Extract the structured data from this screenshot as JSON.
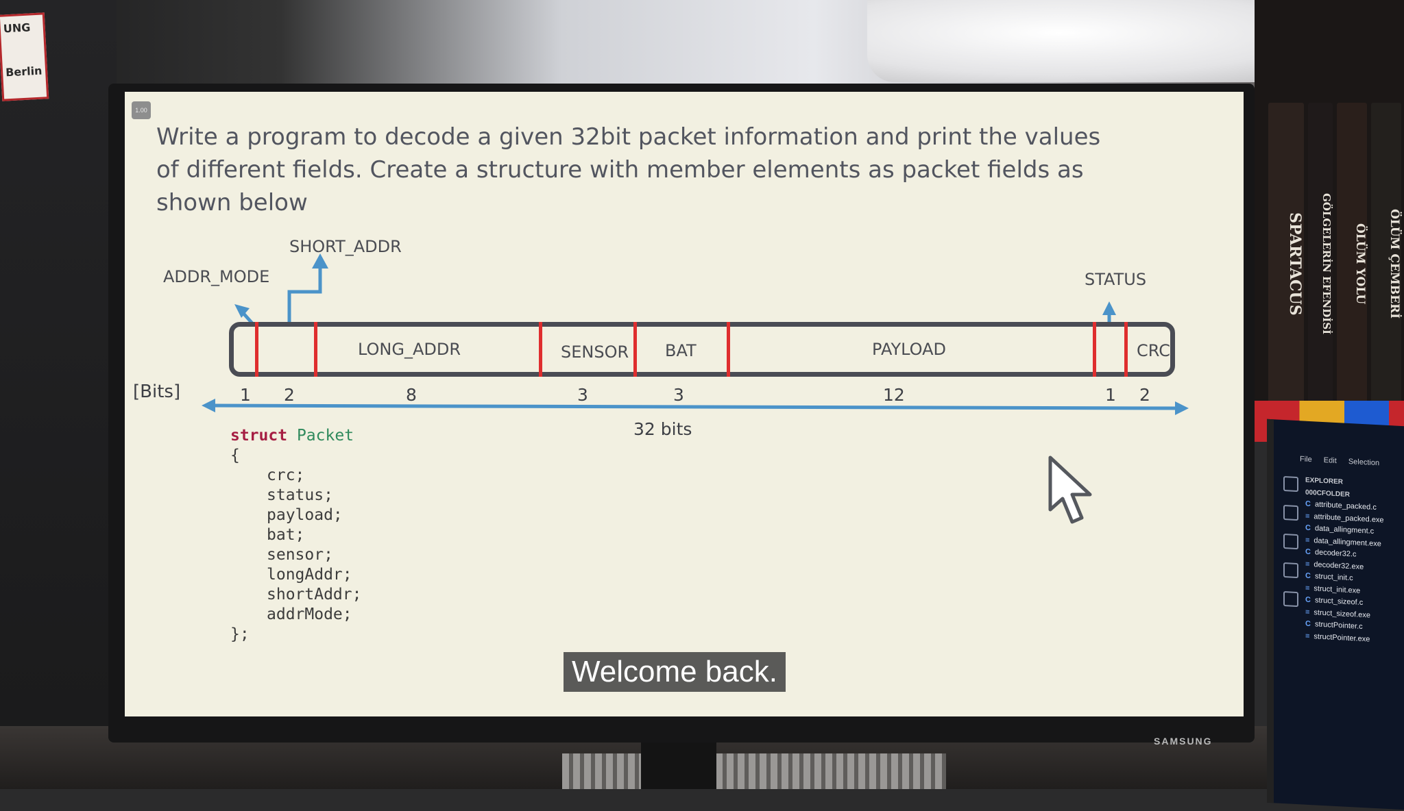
{
  "poster": {
    "line1": "UNG",
    "line2": "Berlin"
  },
  "books": [
    {
      "title": "SPARTACUS",
      "color": "#2c221e"
    },
    {
      "title": "GÖLGELERİN EFENDİSİ",
      "color": "#1f1a1a"
    },
    {
      "title": "ÖLÜM YOLU",
      "color": "#2a1f1b"
    },
    {
      "title": "ÖLÜM ÇEMBERİ",
      "color": "#23201d"
    }
  ],
  "monitor": {
    "brand": "SAMSUNG",
    "speed_badge": "1.00"
  },
  "slide": {
    "prompt": "Write a program to decode a given 32bit packet information  and print the values of different fields. Create a structure with member elements as packet fields as shown below",
    "fields": {
      "short_addr": "SHORT_ADDR",
      "addr_mode": "ADDR_MODE",
      "status": "STATUS",
      "long_addr": "LONG_ADDR",
      "sensor": "SENSOR",
      "bat": "BAT",
      "payload": "PAYLOAD",
      "crc": "CRC"
    },
    "bits_label": "[Bits]",
    "bits": [
      "1",
      "2",
      "8",
      "3",
      "3",
      "12",
      "1",
      "2"
    ],
    "total_label": "32 bits",
    "code": {
      "keyword": "struct",
      "type_name": "Packet",
      "open": "{",
      "members": [
        "crc;",
        "status;",
        "payload;",
        "bat;",
        "sensor;",
        "longAddr;",
        "shortAddr;",
        "addrMode;"
      ],
      "close": "};"
    },
    "subtitle": "Welcome back.",
    "colors": {
      "accent_blue": "#4b93c9",
      "separator_red": "#df2e2e",
      "frame": "#4a4c54"
    }
  },
  "laptop": {
    "menu": [
      "File",
      "Edit",
      "Selection"
    ],
    "explorer_title": "EXPLORER",
    "folder": "000CFOLDER",
    "files": [
      {
        "kind": "C",
        "name": "attribute_packed.c"
      },
      {
        "kind": "≡",
        "name": "attribute_packed.exe"
      },
      {
        "kind": "C",
        "name": "data_allingment.c"
      },
      {
        "kind": "≡",
        "name": "data_allingment.exe"
      },
      {
        "kind": "C",
        "name": "decoder32.c"
      },
      {
        "kind": "≡",
        "name": "decoder32.exe"
      },
      {
        "kind": "C",
        "name": "struct_init.c"
      },
      {
        "kind": "≡",
        "name": "struct_init.exe"
      },
      {
        "kind": "C",
        "name": "struct_sizeof.c"
      },
      {
        "kind": "≡",
        "name": "struct_sizeof.exe"
      },
      {
        "kind": "C",
        "name": "structPointer.c"
      },
      {
        "kind": "≡",
        "name": "structPointer.exe"
      }
    ]
  }
}
